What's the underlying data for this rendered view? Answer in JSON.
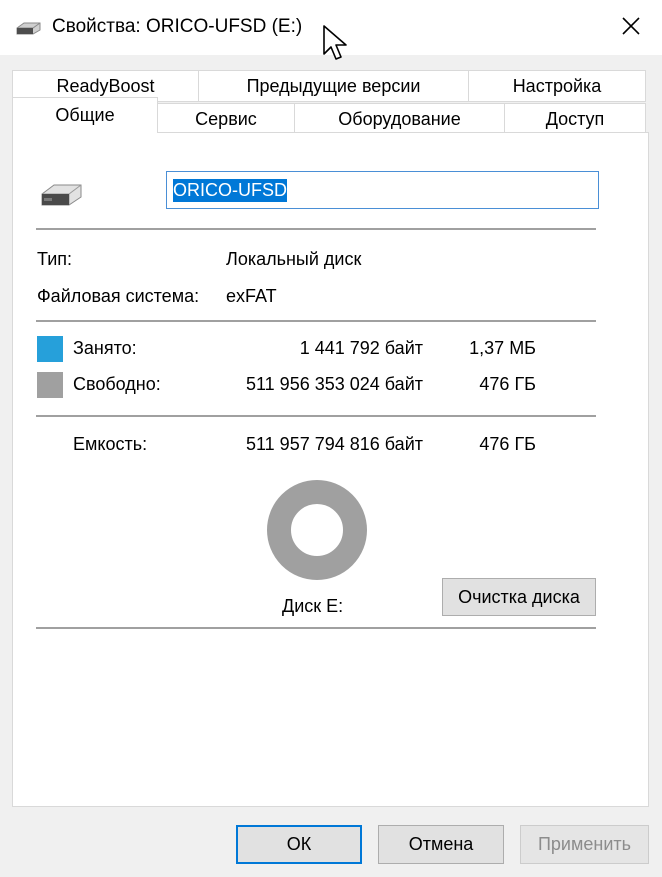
{
  "window": {
    "title": "Свойства: ORICO-UFSD (E:)",
    "close_glyph": "✕"
  },
  "tabs_row1": [
    {
      "label": "ReadyBoost"
    },
    {
      "label": "Предыдущие версии"
    },
    {
      "label": "Настройка"
    }
  ],
  "tabs_row2": [
    {
      "label": "Общие",
      "active": true
    },
    {
      "label": "Сервис"
    },
    {
      "label": "Оборудование"
    },
    {
      "label": "Доступ"
    }
  ],
  "general": {
    "drive_name": "ORICO-UFSD",
    "type_label": "Тип:",
    "type_value": "Локальный диск",
    "fs_label": "Файловая система:",
    "fs_value": "exFAT",
    "used_label": "Занято:",
    "used_bytes": "1 441 792 байт",
    "used_short": "1,37 МБ",
    "free_label": "Свободно:",
    "free_bytes": "511 956 353 024 байт",
    "free_short": "476 ГБ",
    "capacity_label": "Емкость:",
    "capacity_bytes": "511 957 794 816 байт",
    "capacity_short": "476 ГБ",
    "disk_label": "Диск E:",
    "cleanup_button": "Очистка диска",
    "used_fraction": 2.8e-06
  },
  "colors": {
    "used": "#26a0da",
    "free": "#a0a0a0",
    "selection": "#0078d7"
  },
  "buttons": {
    "ok": "ОК",
    "cancel": "Отмена",
    "apply": "Применить"
  }
}
